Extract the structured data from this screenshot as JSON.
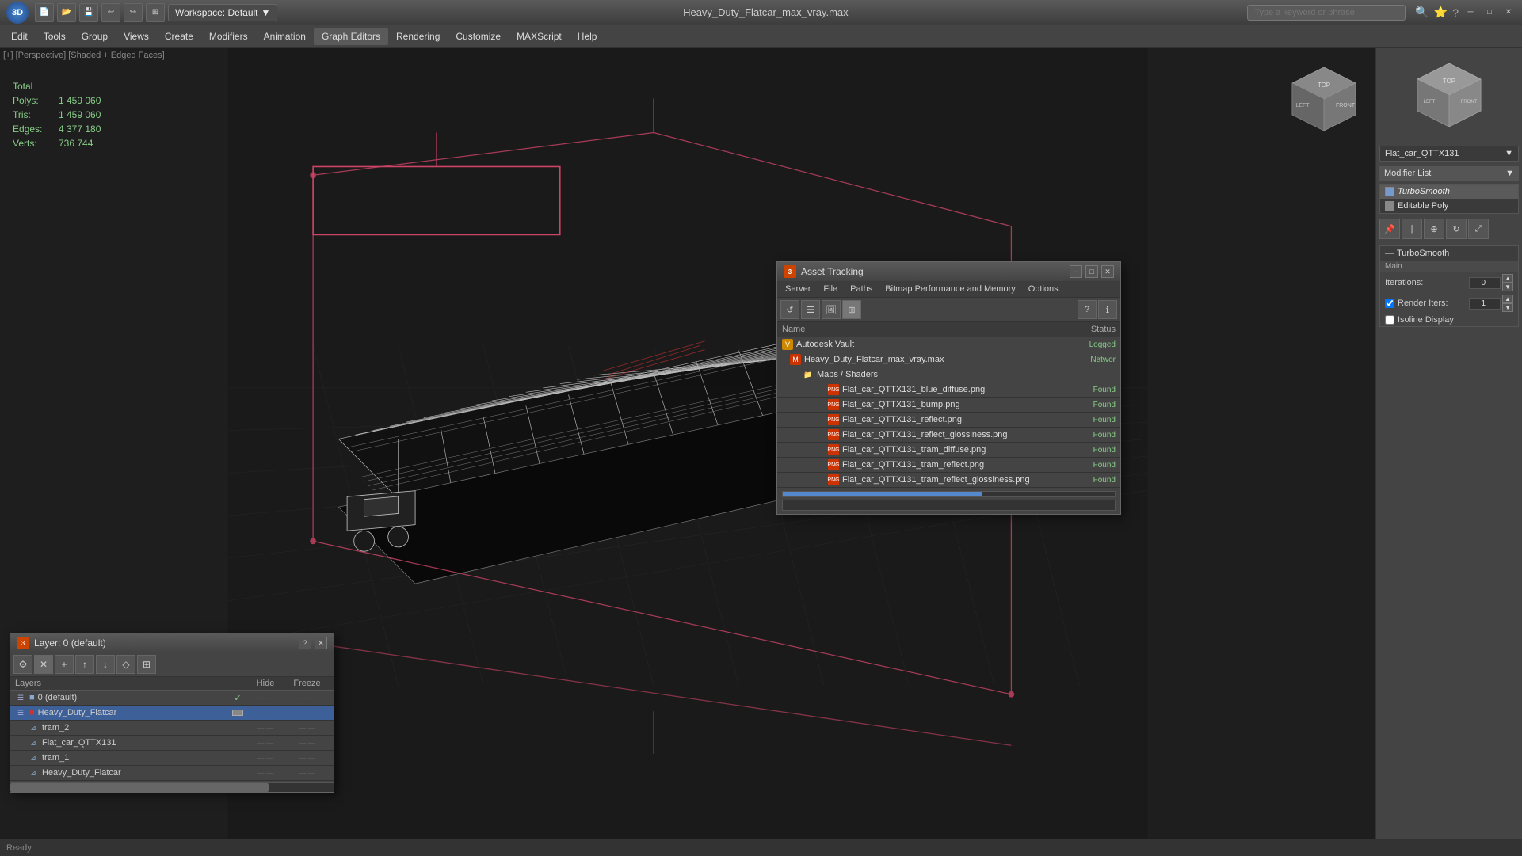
{
  "app": {
    "logo": "3D",
    "title": "Heavy_Duty_Flatcar_max_vray.max",
    "workspace": "Workspace: Default"
  },
  "titlebar": {
    "search_placeholder": "Type a keyword or phrase",
    "search_value": "",
    "quick_access": [
      "open",
      "save",
      "undo",
      "redo",
      "workspace"
    ],
    "win_controls": [
      "minimize",
      "restore",
      "close"
    ]
  },
  "menubar": {
    "items": [
      "Edit",
      "Tools",
      "Group",
      "Views",
      "Create",
      "Modifiers",
      "Animation",
      "Graph Editors",
      "Rendering",
      "Customize",
      "MAXScript",
      "Help"
    ]
  },
  "viewport": {
    "label": "[+] [Perspective] [Shaded + Edged Faces]",
    "stats": {
      "total_label": "Total",
      "polys_label": "Polys:",
      "polys_val": "1 459 060",
      "tris_label": "Tris:",
      "tris_val": "1 459 060",
      "edges_label": "Edges:",
      "edges_val": "4 377 180",
      "verts_label": "Verts:",
      "verts_val": "736 744"
    }
  },
  "right_panel": {
    "object_name": "Flat_car_QTTX131",
    "modifier_list_label": "Modifier List",
    "modifiers": [
      {
        "name": "TurboSmooth",
        "italic": true
      },
      {
        "name": "Editable Poly",
        "italic": false
      }
    ],
    "turbosmooth": {
      "header": "TurboSmooth",
      "section": "Main",
      "iterations_label": "Iterations:",
      "iterations_val": "0",
      "render_iters_label": "Render Iters:",
      "render_iters_val": "1",
      "isoline_label": "Isoline Display"
    }
  },
  "asset_tracking": {
    "title": "Asset Tracking",
    "menu": [
      "Server",
      "File",
      "Paths",
      "Bitmap Performance and Memory",
      "Options"
    ],
    "columns": {
      "name": "Name",
      "status": "Status"
    },
    "rows": [
      {
        "level": 0,
        "icon": "vault",
        "name": "Autodesk Vault",
        "status": "Logged"
      },
      {
        "level": 1,
        "icon": "max",
        "name": "Heavy_Duty_Flatcar_max_vray.max",
        "status": "Networ"
      },
      {
        "level": 2,
        "icon": "folder",
        "name": "Maps / Shaders",
        "status": ""
      },
      {
        "level": 3,
        "icon": "png",
        "name": "Flat_car_QTTX131_blue_diffuse.png",
        "status": "Found"
      },
      {
        "level": 3,
        "icon": "png",
        "name": "Flat_car_QTTX131_bump.png",
        "status": "Found"
      },
      {
        "level": 3,
        "icon": "png",
        "name": "Flat_car_QTTX131_reflect.png",
        "status": "Found"
      },
      {
        "level": 3,
        "icon": "png",
        "name": "Flat_car_QTTX131_reflect_glossiness.png",
        "status": "Found"
      },
      {
        "level": 3,
        "icon": "png",
        "name": "Flat_car_QTTX131_tram_diffuse.png",
        "status": "Found"
      },
      {
        "level": 3,
        "icon": "png",
        "name": "Flat_car_QTTX131_tram_reflect.png",
        "status": "Found"
      },
      {
        "level": 3,
        "icon": "png",
        "name": "Flat_car_QTTX131_tram_reflect_glossiness.png",
        "status": "Found"
      }
    ]
  },
  "layer_window": {
    "title": "Layer: 0 (default)",
    "columns": {
      "name": "Layers",
      "hide": "Hide",
      "freeze": "Freeze"
    },
    "rows": [
      {
        "level": 0,
        "icon": "layer",
        "name": "0 (default)",
        "has_check": true,
        "selected": false
      },
      {
        "level": 0,
        "icon": "layer",
        "name": "Heavy_Duty_Flatcar",
        "has_box": true,
        "selected": true
      },
      {
        "level": 1,
        "icon": "obj",
        "name": "tram_2",
        "selected": false
      },
      {
        "level": 1,
        "icon": "obj",
        "name": "Flat_car_QTTX131",
        "selected": false
      },
      {
        "level": 1,
        "icon": "obj",
        "name": "tram_1",
        "selected": false
      },
      {
        "level": 1,
        "icon": "obj",
        "name": "Heavy_Duty_Flatcar",
        "selected": false
      }
    ]
  }
}
